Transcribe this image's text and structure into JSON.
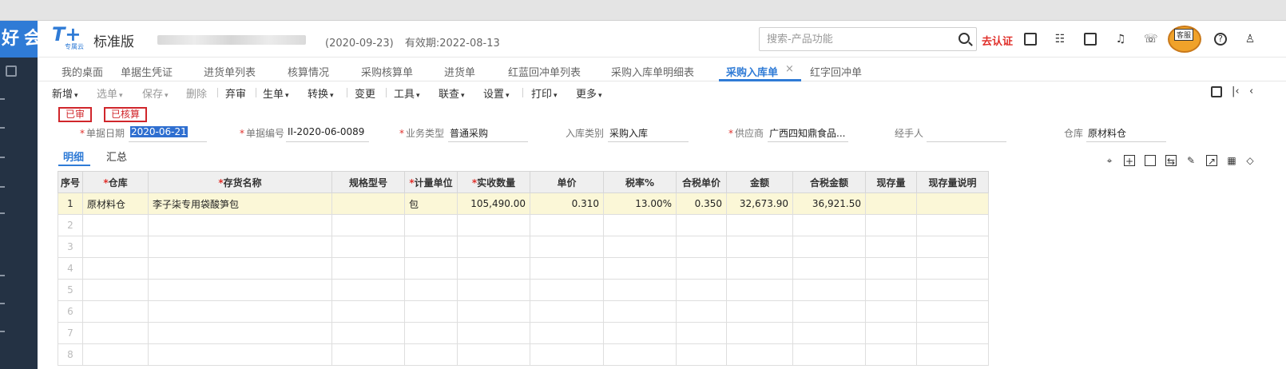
{
  "sidebar": {
    "brand": "好会通"
  },
  "header": {
    "logo_text": "T+",
    "logo_sub": "专属云",
    "edition": "标准版",
    "date_range": "(2020-09-23)",
    "validity": "有效期:2022-08-13",
    "search_placeholder": "搜索-产品功能",
    "certify_label": "去认证",
    "service_label": "客服"
  },
  "tabs": [
    {
      "label": "我的桌面"
    },
    {
      "label": "单据生凭证"
    },
    {
      "label": "进货单列表"
    },
    {
      "label": "核算情况"
    },
    {
      "label": "采购核算单"
    },
    {
      "label": "进货单"
    },
    {
      "label": "红蓝回冲单列表"
    },
    {
      "label": "采购入库单明细表"
    },
    {
      "label": "采购入库单"
    },
    {
      "label": "红字回冲单"
    }
  ],
  "tab_close": "×",
  "toolbar": [
    {
      "label": "新增",
      "caret": "▾"
    },
    {
      "label": "选单",
      "caret": "▾"
    },
    {
      "label": "保存",
      "caret": "▾"
    },
    {
      "label": "删除",
      "caret": ""
    },
    {
      "label": "弃审",
      "caret": ""
    },
    {
      "label": "生单",
      "caret": "▾"
    },
    {
      "label": "转换",
      "caret": "▾"
    },
    {
      "label": "变更",
      "caret": ""
    },
    {
      "label": "工具",
      "caret": "▾"
    },
    {
      "label": "联查",
      "caret": "▾"
    },
    {
      "label": "设置",
      "caret": "▾"
    },
    {
      "label": "打印",
      "caret": "▾"
    },
    {
      "label": "更多",
      "caret": "▾"
    }
  ],
  "stamps": {
    "approved": "已审",
    "accounted": "已核算"
  },
  "form": {
    "date_label": "单据日期",
    "date_value": "2020-06-21",
    "number_label": "单据编号",
    "number_value": "II-2020-06-0089",
    "biz_type_label": "业务类型",
    "biz_type_value": "普通采购",
    "in_type_label": "入库类别",
    "in_type_value": "采购入库",
    "supplier_label": "供应商",
    "supplier_value": "广西四知鼎食品...",
    "handler_label": "经手人",
    "handler_value": "",
    "warehouse_label": "仓库",
    "warehouse_value": "原材料仓"
  },
  "subtabs": {
    "detail": "明细",
    "summary": "汇总"
  },
  "table": {
    "headers": [
      "序号",
      "仓库",
      "存货名称",
      "规格型号",
      "计量单位",
      "实收数量",
      "单价",
      "税率%",
      "合税单价",
      "金额",
      "合税金额",
      "现存量",
      "现存量说明"
    ],
    "rows": [
      [
        "1",
        "原材料仓",
        "李子柒专用袋酸笋包",
        "",
        "包",
        "105,490.00",
        "0.310",
        "13.00%",
        "0.350",
        "32,673.90",
        "36,921.50",
        "",
        ""
      ],
      [
        "2",
        "",
        "",
        "",
        "",
        "",
        "",
        "",
        "",
        "",
        "",
        "",
        ""
      ],
      [
        "3",
        "",
        "",
        "",
        "",
        "",
        "",
        "",
        "",
        "",
        "",
        "",
        ""
      ],
      [
        "4",
        "",
        "",
        "",
        "",
        "",
        "",
        "",
        "",
        "",
        "",
        "",
        ""
      ],
      [
        "5",
        "",
        "",
        "",
        "",
        "",
        "",
        "",
        "",
        "",
        "",
        "",
        ""
      ],
      [
        "6",
        "",
        "",
        "",
        "",
        "",
        "",
        "",
        "",
        "",
        "",
        "",
        ""
      ],
      [
        "7",
        "",
        "",
        "",
        "",
        "",
        "",
        "",
        "",
        "",
        "",
        "",
        ""
      ],
      [
        "8",
        "",
        "",
        "",
        "",
        "",
        "",
        "",
        "",
        "",
        "",
        "",
        ""
      ]
    ]
  },
  "colors": {
    "accent": "#2f7bd6",
    "sidebar": "#243244",
    "required": "#e0302b",
    "active_row": "#fbf7d7"
  }
}
